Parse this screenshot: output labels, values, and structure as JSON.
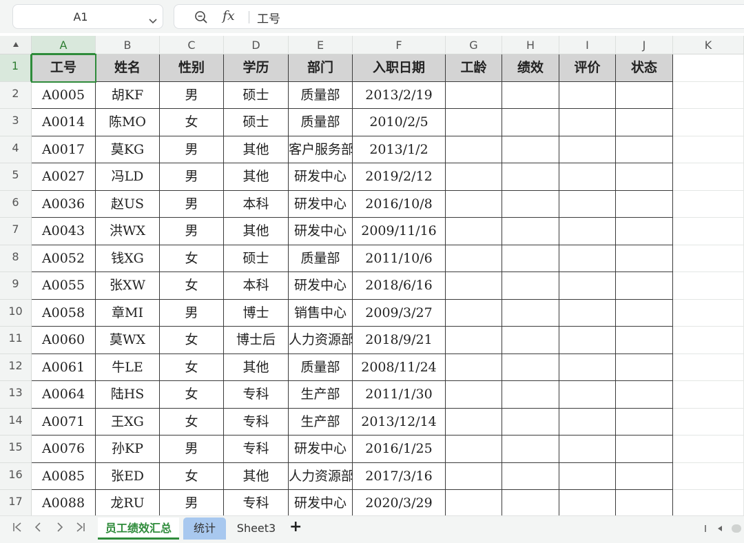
{
  "formula_bar": {
    "name_box": "A1",
    "content": "工号",
    "fx_label": "fx"
  },
  "columns": [
    "A",
    "B",
    "C",
    "D",
    "E",
    "F",
    "G",
    "H",
    "I",
    "J",
    "K"
  ],
  "rows": [
    "1",
    "2",
    "3",
    "4",
    "5",
    "6",
    "7",
    "8",
    "9",
    "10",
    "11",
    "12",
    "13",
    "14",
    "15",
    "16",
    "17"
  ],
  "table": {
    "headers": [
      "工号",
      "姓名",
      "性别",
      "学历",
      "部门",
      "入职日期",
      "工龄",
      "绩效",
      "评价",
      "状态"
    ],
    "rows": [
      [
        "A0005",
        "胡KF",
        "男",
        "硕士",
        "质量部",
        "2013/2/19",
        "",
        "",
        "",
        ""
      ],
      [
        "A0014",
        "陈MO",
        "女",
        "硕士",
        "质量部",
        "2010/2/5",
        "",
        "",
        "",
        ""
      ],
      [
        "A0017",
        "莫KG",
        "男",
        "其他",
        "客户服务部",
        "2013/1/2",
        "",
        "",
        "",
        ""
      ],
      [
        "A0027",
        "冯LD",
        "男",
        "其他",
        "研发中心",
        "2019/2/12",
        "",
        "",
        "",
        ""
      ],
      [
        "A0036",
        "赵US",
        "男",
        "本科",
        "研发中心",
        "2016/10/8",
        "",
        "",
        "",
        ""
      ],
      [
        "A0043",
        "洪WX",
        "男",
        "其他",
        "研发中心",
        "2009/11/16",
        "",
        "",
        "",
        ""
      ],
      [
        "A0052",
        "钱XG",
        "女",
        "硕士",
        "质量部",
        "2011/10/6",
        "",
        "",
        "",
        ""
      ],
      [
        "A0055",
        "张XW",
        "女",
        "本科",
        "研发中心",
        "2018/6/16",
        "",
        "",
        "",
        ""
      ],
      [
        "A0058",
        "章MI",
        "男",
        "博士",
        "销售中心",
        "2009/3/27",
        "",
        "",
        "",
        ""
      ],
      [
        "A0060",
        "莫WX",
        "女",
        "博士后",
        "人力资源部",
        "2018/9/21",
        "",
        "",
        "",
        ""
      ],
      [
        "A0061",
        "牛LE",
        "女",
        "其他",
        "质量部",
        "2008/11/24",
        "",
        "",
        "",
        ""
      ],
      [
        "A0064",
        "陆HS",
        "女",
        "专科",
        "生产部",
        "2011/1/30",
        "",
        "",
        "",
        ""
      ],
      [
        "A0071",
        "王XG",
        "女",
        "专科",
        "生产部",
        "2013/12/14",
        "",
        "",
        "",
        ""
      ],
      [
        "A0076",
        "孙KP",
        "男",
        "专科",
        "研发中心",
        "2016/1/25",
        "",
        "",
        "",
        ""
      ],
      [
        "A0085",
        "张ED",
        "女",
        "其他",
        "人力资源部",
        "2017/3/16",
        "",
        "",
        "",
        ""
      ],
      [
        "A0088",
        "龙RU",
        "男",
        "专科",
        "研发中心",
        "2020/3/29",
        "",
        "",
        "",
        ""
      ]
    ]
  },
  "sheet_tabs": [
    {
      "label": "员工绩效汇总",
      "active": true
    },
    {
      "label": "统计",
      "active": false
    },
    {
      "label": "Sheet3",
      "active": false
    }
  ],
  "add_sheet_label": "+",
  "colors": {
    "accent": "#2e8b3a",
    "header_fill": "#d4d4d4",
    "tab_blue": "#a8c8ef"
  }
}
